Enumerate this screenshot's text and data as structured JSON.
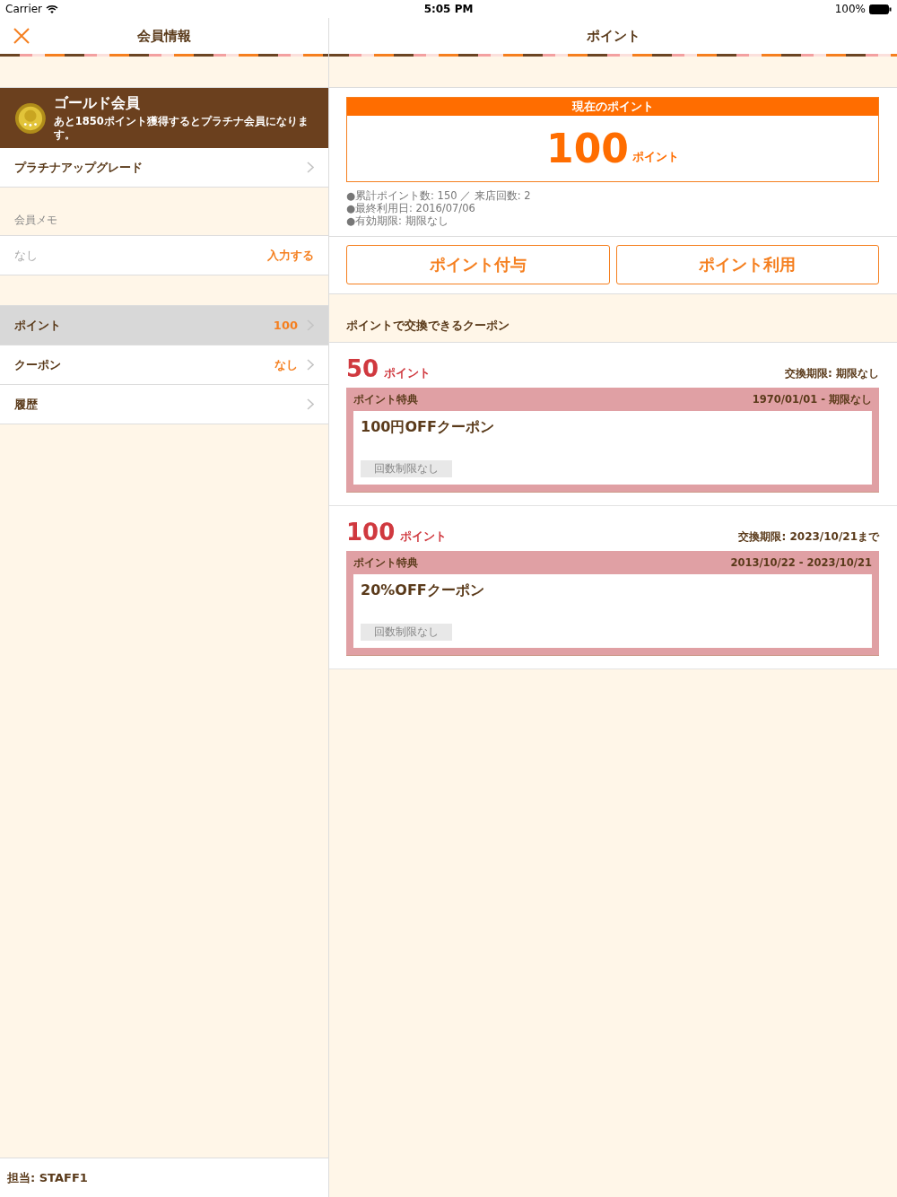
{
  "status_bar": {
    "carrier": "Carrier",
    "time": "5:05 PM",
    "battery": "100%"
  },
  "left": {
    "title": "会員情報",
    "rank": {
      "title": "ゴールド会員",
      "message": "あと1850ポイント獲得するとプラチナ会員になります。"
    },
    "upgrade": "プラチナアップグレード",
    "memo_label": "会員メモ",
    "memo": {
      "value": "なし",
      "action": "入力する"
    },
    "menu": [
      {
        "label": "ポイント",
        "value": "100",
        "selected": true
      },
      {
        "label": "クーポン",
        "value": "なし",
        "selected": false
      },
      {
        "label": "履歴",
        "selected": false
      }
    ],
    "staff": "担当: STAFF1"
  },
  "right": {
    "title": "ポイント",
    "current": {
      "header": "現在のポイント",
      "value": "100",
      "unit": "ポイント"
    },
    "notes": [
      "●累計ポイント数: 150 ／ 来店回数: 2",
      "●最終利用日: 2016/07/06",
      "●有効期限: 期限なし"
    ],
    "buttons": [
      "ポイント付与",
      "ポイント利用"
    ],
    "coupons_label": "ポイントで交換できるクーポン",
    "coupons": [
      {
        "points": "50",
        "unit": "ポイント",
        "exchange_limit": "交換期限: 期限なし",
        "tag": "ポイント特典",
        "period": "1970/01/01 - 期限なし",
        "name": "100円OFFクーポン",
        "usage": "回数制限なし"
      },
      {
        "points": "100",
        "unit": "ポイント",
        "exchange_limit": "交換期限: 2023/10/21まで",
        "tag": "ポイント特典",
        "period": "2013/10/22 - 2023/10/21",
        "name": "20%OFFクーポン",
        "usage": "回数制限なし"
      }
    ]
  }
}
